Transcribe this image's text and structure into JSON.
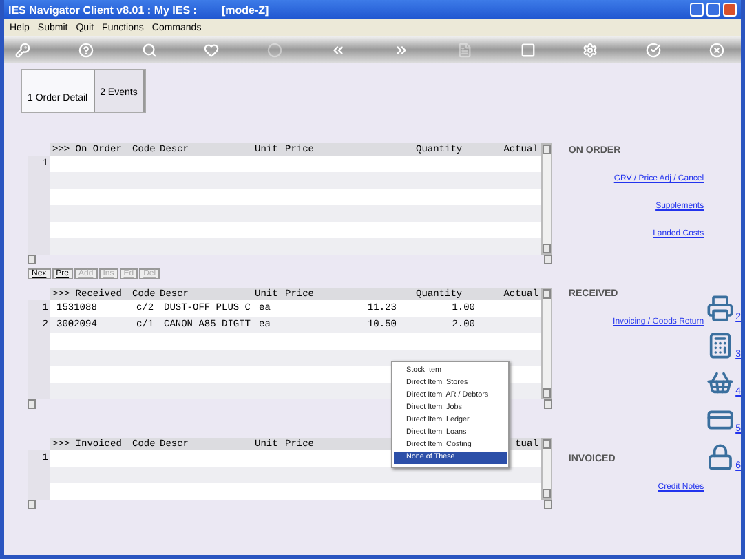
{
  "window": {
    "title": "IES Navigator Client v8.01 : My IES :",
    "mode": "[mode-Z]"
  },
  "menu": [
    "Help",
    "Submit",
    "Quit",
    "Functions",
    "Commands"
  ],
  "toolbar": [
    {
      "kind": "key",
      "disabled": false
    },
    {
      "kind": "help",
      "disabled": false
    },
    {
      "kind": "search",
      "disabled": false
    },
    {
      "kind": "heart",
      "disabled": false
    },
    {
      "kind": "circle",
      "disabled": true
    },
    {
      "kind": "back",
      "disabled": false
    },
    {
      "kind": "forward",
      "disabled": false
    },
    {
      "kind": "document",
      "disabled": true
    },
    {
      "kind": "stop",
      "disabled": false
    },
    {
      "kind": "gear",
      "disabled": false
    },
    {
      "kind": "check",
      "disabled": false
    },
    {
      "kind": "close",
      "disabled": false
    }
  ],
  "tabs": [
    {
      "label": "1 Order Detail",
      "selected": true
    },
    {
      "label": "2 Events",
      "selected": false
    }
  ],
  "grids": [
    {
      "columns": [
        ">>> On Order",
        "Code",
        "Descr",
        "Unit",
        "Price",
        "Quantity",
        "Actual"
      ],
      "rows": [
        {
          "number": "1",
          "cells": []
        }
      ]
    },
    {
      "columns": [
        ">>> Received",
        "Code",
        "Descr",
        "Unit",
        "Price",
        "Quantity",
        "Actual"
      ],
      "rows": [
        {
          "number": "1",
          "cells": [
            "1531088",
            "c/2",
            "DUST-OFF PLUS C",
            "ea",
            "11.23",
            "1.00"
          ]
        },
        {
          "number": "2",
          "cells": [
            "3002094",
            "c/1",
            "CANON A85 DIGIT",
            "ea",
            "10.50",
            "2.00"
          ]
        }
      ]
    },
    {
      "columns": [
        ">>> Invoiced",
        "Code",
        "Descr",
        "Unit",
        "Price",
        "tual"
      ],
      "rows": [
        {
          "number": "1",
          "cells": []
        }
      ]
    }
  ],
  "record_buttons": [
    {
      "label": "Nex",
      "disabled": false
    },
    {
      "label": "Pre",
      "disabled": false
    },
    {
      "label": "Add",
      "disabled": true
    },
    {
      "label": "Ins",
      "disabled": true
    },
    {
      "label": "Ed",
      "disabled": true
    },
    {
      "label": "Del",
      "disabled": true
    }
  ],
  "sections": [
    {
      "title": "ON ORDER",
      "links": [
        "GRV / Price Adj / Cancel",
        "Supplements",
        "Landed Costs"
      ]
    },
    {
      "title": "RECEIVED",
      "links": [
        "Invoicing / Goods Return"
      ]
    },
    {
      "title": "INVOICED",
      "links": [
        "Credit Notes"
      ]
    }
  ],
  "shortcuts": [
    {
      "kind": "printer",
      "number": "2"
    },
    {
      "kind": "calculator",
      "number": "3"
    },
    {
      "kind": "basket",
      "number": "4"
    },
    {
      "kind": "card",
      "number": "5"
    },
    {
      "kind": "lock",
      "number": "6"
    }
  ],
  "context_menu": [
    {
      "label": "Stock Item",
      "selected": false
    },
    {
      "label": "Direct Item: Stores",
      "selected": false
    },
    {
      "label": "Direct Item: AR / Debtors",
      "selected": false
    },
    {
      "label": "Direct Item: Jobs",
      "selected": false
    },
    {
      "label": "Direct Item: Ledger",
      "selected": false
    },
    {
      "label": "Direct Item: Loans",
      "selected": false
    },
    {
      "label": "Direct Item: Costing",
      "selected": false
    },
    {
      "label": "None of These",
      "selected": true
    }
  ]
}
